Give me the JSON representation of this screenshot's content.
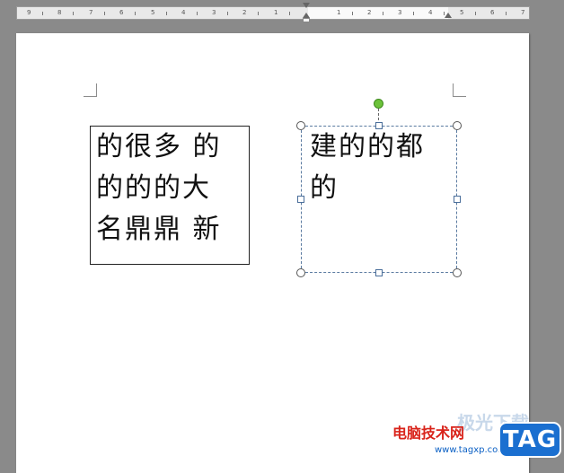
{
  "ruler": {
    "left_numbers": [
      "9",
      "8",
      "7",
      "6",
      "5",
      "4",
      "3",
      "2",
      "1"
    ],
    "right_numbers": [
      "1",
      "2",
      "3",
      "4",
      "5",
      "6",
      "7"
    ]
  },
  "textbox1": {
    "lines": [
      "的很多 的",
      "的的的大",
      "名鼎鼎 新"
    ]
  },
  "textbox2": {
    "lines": [
      "建的的都",
      "的"
    ]
  },
  "watermark": {
    "site_cn": "电脑技术网",
    "url": "www.tagxp.com",
    "ghost": "极光下载",
    "tag": "TAG"
  },
  "colors": {
    "ruler_bg": "#e9e9e9",
    "page_bg": "#ffffff",
    "desk_bg": "#8a8a8a",
    "rotate_handle": "#6cc23a",
    "tag_blue": "#1a6fd0",
    "watermark_red": "#d9241b"
  }
}
